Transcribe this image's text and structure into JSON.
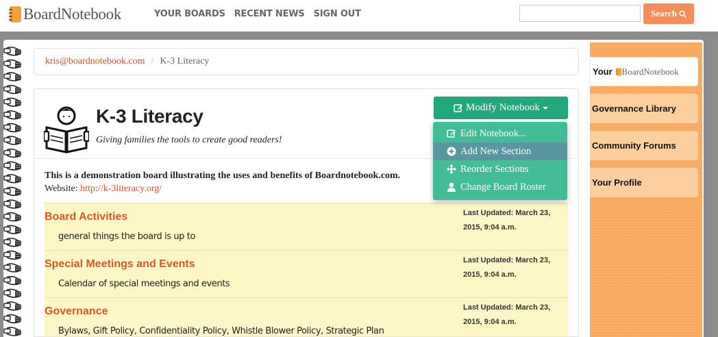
{
  "header": {
    "logo_text": "BoardNotebook",
    "nav": [
      "YOUR BOARDS",
      "RECENT NEWS",
      "SIGN OUT"
    ],
    "search": {
      "placeholder": "",
      "button_label": "Search"
    }
  },
  "breadcrumb": {
    "user": "kris@boardnotebook.com",
    "separator": "/",
    "current": "K-3 Literacy"
  },
  "board": {
    "title": "K-3 Literacy",
    "tagline": "Giving families the tools to create good readers!",
    "description": "This is a demonstration board illustrating the uses and benefits of Boardnotebook.com.",
    "website_label": "Website:",
    "website_url": "http://k-3literacy.org/",
    "modify_label": "Modify Notebook"
  },
  "dropdown": {
    "items": [
      {
        "label": "Edit Notebook...",
        "icon": "edit-icon"
      },
      {
        "label": "Add New Section",
        "icon": "plus-circle-icon",
        "active": true
      },
      {
        "label": "Reorder Sections",
        "icon": "move-icon"
      },
      {
        "label": "Change Board Roster",
        "icon": "user-icon"
      }
    ]
  },
  "sections": [
    {
      "title": "Board Activities",
      "description": "general things the board is up to",
      "updated_line1": "Last Updated: March 23,",
      "updated_line2": "2015, 9:04 a.m."
    },
    {
      "title": "Special Meetings and Events",
      "description": "Calendar of special meetings and events",
      "updated_line1": "Last Updated: March 23,",
      "updated_line2": "2015, 9:04 a.m."
    },
    {
      "title": "Governance",
      "description": "Bylaws, Gift Policy, Confidentiality Policy, Whistle Blower Policy, Strategic Plan",
      "updated_line1": "Last Updated: March 23,",
      "updated_line2": "2015, 9:04 a.m."
    }
  ],
  "sidebar": {
    "your_label": "Your",
    "your_logo": "BoardNotebook",
    "items": [
      "Governance Library",
      "Community Forums",
      "Your Profile"
    ]
  },
  "colors": {
    "accent_orange": "#d8591f",
    "green": "#22a87d",
    "sidebar_orange": "#f8a85e",
    "section_yellow": "#fdf6c6"
  }
}
